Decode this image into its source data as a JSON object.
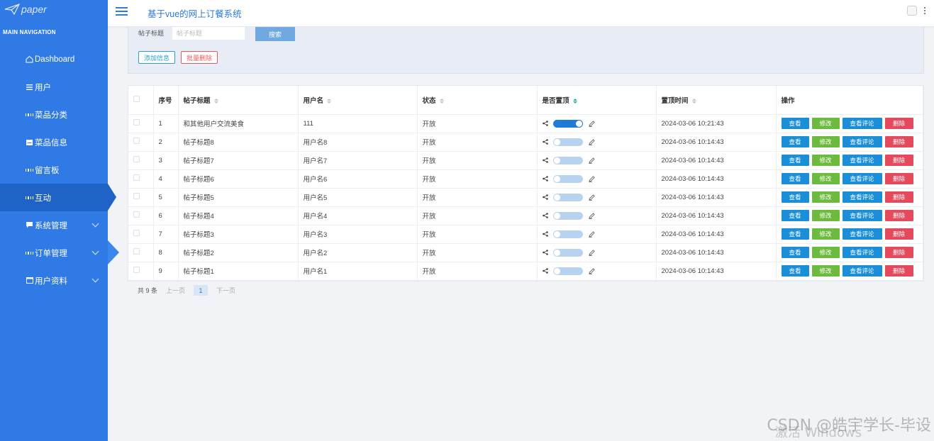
{
  "sidebar": {
    "logo_text": "paper",
    "nav_heading": "MAIN NAVIGATION",
    "items": [
      {
        "label": "Dashboard",
        "icon": "home-icon"
      },
      {
        "label": "用户",
        "icon": "list-icon"
      },
      {
        "label": "菜品分类",
        "icon": "grid-icon"
      },
      {
        "label": "菜品信息",
        "icon": "card-icon"
      },
      {
        "label": "留言板",
        "icon": "grid-icon"
      },
      {
        "label": "互动",
        "icon": "grid-icon",
        "active": true
      },
      {
        "label": "系统管理",
        "icon": "chat-icon",
        "expandable": true
      },
      {
        "label": "订单管理",
        "icon": "grid-icon",
        "expandable": true
      },
      {
        "label": "用户资料",
        "icon": "window-icon",
        "expandable": true
      }
    ]
  },
  "header": {
    "title": "基于vue的网上订餐系统"
  },
  "search": {
    "label": "帖子标题",
    "placeholder": "帖子标题",
    "button": "搜索",
    "add_button": "添加信息",
    "batch_delete_button": "批量删除"
  },
  "table": {
    "columns": [
      "序号",
      "帖子标题",
      "用户名",
      "状态",
      "是否置顶",
      "置顶时间",
      "操作"
    ],
    "rows": [
      {
        "index": "1",
        "title": "和其他用户交流美食",
        "user": "111",
        "status": "开放",
        "pinned": true,
        "time": "2024-03-06 10:21:43"
      },
      {
        "index": "2",
        "title": "帖子标题8",
        "user": "用户名8",
        "status": "开放",
        "pinned": false,
        "time": "2024-03-06 10:14:43"
      },
      {
        "index": "3",
        "title": "帖子标题7",
        "user": "用户名7",
        "status": "开放",
        "pinned": false,
        "time": "2024-03-06 10:14:43"
      },
      {
        "index": "4",
        "title": "帖子标题6",
        "user": "用户名6",
        "status": "开放",
        "pinned": false,
        "time": "2024-03-06 10:14:43"
      },
      {
        "index": "5",
        "title": "帖子标题5",
        "user": "用户名5",
        "status": "开放",
        "pinned": false,
        "time": "2024-03-06 10:14:43"
      },
      {
        "index": "6",
        "title": "帖子标题4",
        "user": "用户名4",
        "status": "开放",
        "pinned": false,
        "time": "2024-03-06 10:14:43"
      },
      {
        "index": "7",
        "title": "帖子标题3",
        "user": "用户名3",
        "status": "开放",
        "pinned": false,
        "time": "2024-03-06 10:14:43"
      },
      {
        "index": "8",
        "title": "帖子标题2",
        "user": "用户名2",
        "status": "开放",
        "pinned": false,
        "time": "2024-03-06 10:14:43"
      },
      {
        "index": "9",
        "title": "帖子标题1",
        "user": "用户名1",
        "status": "开放",
        "pinned": false,
        "time": "2024-03-06 10:14:43"
      }
    ],
    "actions": {
      "view": "查看",
      "edit": "修改",
      "comments": "查看评论",
      "delete": "删除"
    }
  },
  "pagination": {
    "total": "共 9 条",
    "prev": "上一页",
    "current": "1",
    "next": "下一页"
  },
  "watermarks": {
    "csdn": "CSDN @皓宇学长-毕设",
    "windows": "激活 Windows"
  },
  "colors": {
    "sidebar": "#2f7ae5",
    "accent": "#2a7ad8",
    "view_button": "#1a8fd8",
    "edit_button": "#6dbb3e",
    "delete_button": "#e44a5c"
  }
}
